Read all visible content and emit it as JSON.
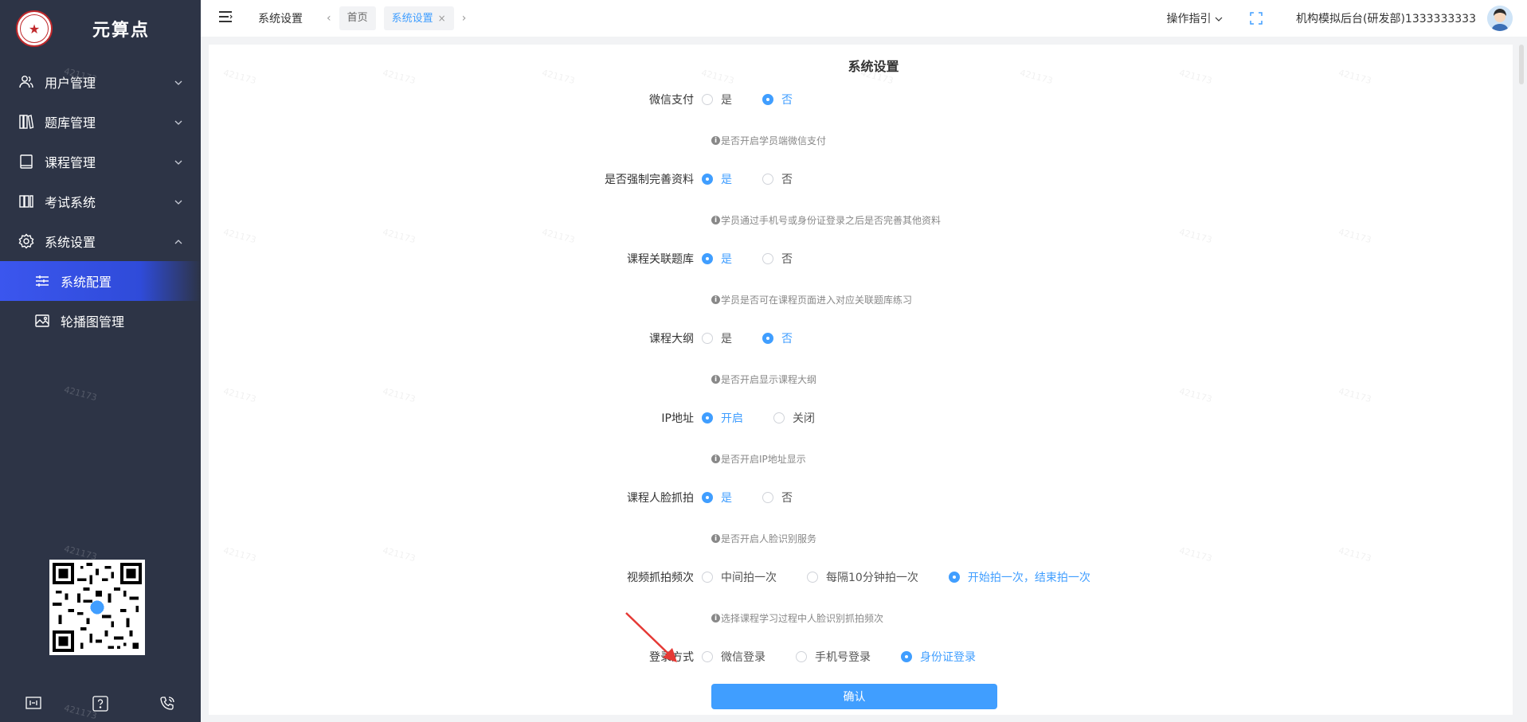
{
  "sidebar": {
    "brand": "元算点",
    "watermark": "421173",
    "items": [
      {
        "label": "用户管理",
        "icon": "users-icon"
      },
      {
        "label": "题库管理",
        "icon": "books-icon"
      },
      {
        "label": "课程管理",
        "icon": "book-icon"
      },
      {
        "label": "考试系统",
        "icon": "exam-icon"
      },
      {
        "label": "系统设置",
        "icon": "gear-icon"
      }
    ],
    "sub_items": [
      {
        "label": "系统配置",
        "icon": "sliders-icon"
      },
      {
        "label": "轮播图管理",
        "icon": "image-icon"
      }
    ]
  },
  "header": {
    "title": "系统设置",
    "tags": [
      {
        "label": "首页"
      },
      {
        "label": "系统设置",
        "close": "×"
      }
    ],
    "guide": "操作指引",
    "org": "机构模拟后台(研发部)1333333333"
  },
  "main": {
    "title": "系统设置",
    "watermark": "421173",
    "fields": [
      {
        "label": "微信支付",
        "options": [
          "是",
          "否"
        ],
        "selected": 1,
        "hint": "是否开启学员端微信支付"
      },
      {
        "label": "是否强制完善资料",
        "options": [
          "是",
          "否"
        ],
        "selected": 0,
        "hint": "学员通过手机号或身份证登录之后是否完善其他资料"
      },
      {
        "label": "课程关联题库",
        "options": [
          "是",
          "否"
        ],
        "selected": 0,
        "hint": "学员是否可在课程页面进入对应关联题库练习"
      },
      {
        "label": "课程大纲",
        "options": [
          "是",
          "否"
        ],
        "selected": 1,
        "hint": "是否开启显示课程大纲"
      },
      {
        "label": "IP地址",
        "options": [
          "开启",
          "关闭"
        ],
        "selected": 0,
        "hint": "是否开启IP地址显示"
      },
      {
        "label": "课程人脸抓拍",
        "options": [
          "是",
          "否"
        ],
        "selected": 0,
        "hint": "是否开启人脸识别服务"
      },
      {
        "label": "视频抓拍频次",
        "options": [
          "中间拍一次",
          "每隔10分钟拍一次",
          "开始拍一次，结束拍一次"
        ],
        "selected": 2,
        "hint": "选择课程学习过程中人脸识别抓拍频次"
      },
      {
        "label": "登录方式",
        "options": [
          "微信登录",
          "手机号登录",
          "身份证登录"
        ],
        "selected": 2,
        "hint": ""
      }
    ],
    "confirm": "确认"
  },
  "colors": {
    "sidebar_bg": "#2d3446",
    "accent": "#409eff",
    "active_menu": "#3b56ee",
    "annotation_arrow": "#e53935"
  }
}
